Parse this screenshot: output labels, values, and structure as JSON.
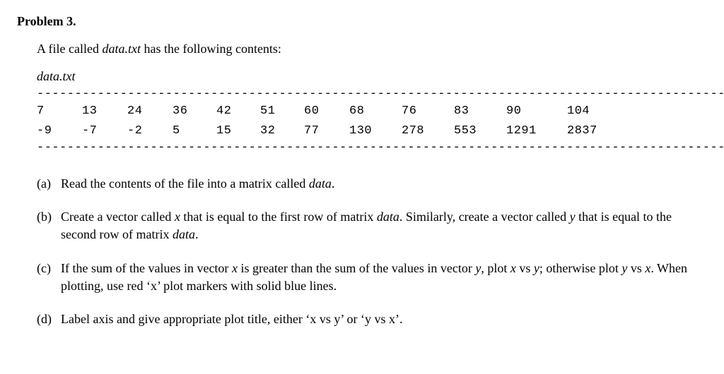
{
  "problem": {
    "title": "Problem 3.",
    "intro_prefix": "A file called ",
    "intro_filename": "data.txt",
    "intro_suffix": " has the following contents:",
    "filename_label": "data.txt",
    "dashes": "-----------------------------------------------------------------------------------------------------------------------",
    "row1": [
      "7",
      "13",
      "24",
      "36",
      "42",
      "51",
      "60",
      "68",
      "76",
      "83",
      "90",
      "104"
    ],
    "row2": [
      "-9",
      "-7",
      "-2",
      "5",
      "15",
      "32",
      "77",
      "130",
      "278",
      "553",
      "1291",
      "2837"
    ],
    "parts": {
      "a": {
        "label": "(a)",
        "t0": "Read the contents of the file into a matrix called ",
        "i1": "data",
        "t1": "."
      },
      "b": {
        "label": "(b)",
        "t0": "Create a vector called ",
        "i1": "x",
        "t1": " that is equal to the first row of matrix ",
        "i2": "data",
        "t2": ". Similarly, create a vector called ",
        "i3": "y",
        "t3": " that is equal to the second row of matrix ",
        "i4": "data",
        "t4": "."
      },
      "c": {
        "label": "(c)",
        "t0": "If the sum of the values in vector ",
        "i1": "x",
        "t1": " is greater than the sum of the values in vector ",
        "i2": "y",
        "t2": ", plot ",
        "i3": "x",
        "t3": " vs ",
        "i4": "y",
        "t4": "; otherwise plot ",
        "i5": "y",
        "t5": " vs ",
        "i6": "x",
        "t6": ". When plotting, use red ‘x’ plot markers with solid blue lines."
      },
      "d": {
        "label": "(d)",
        "t0": "Label axis and give appropriate plot title, either ‘x vs y’ or ‘y vs x’."
      }
    }
  }
}
